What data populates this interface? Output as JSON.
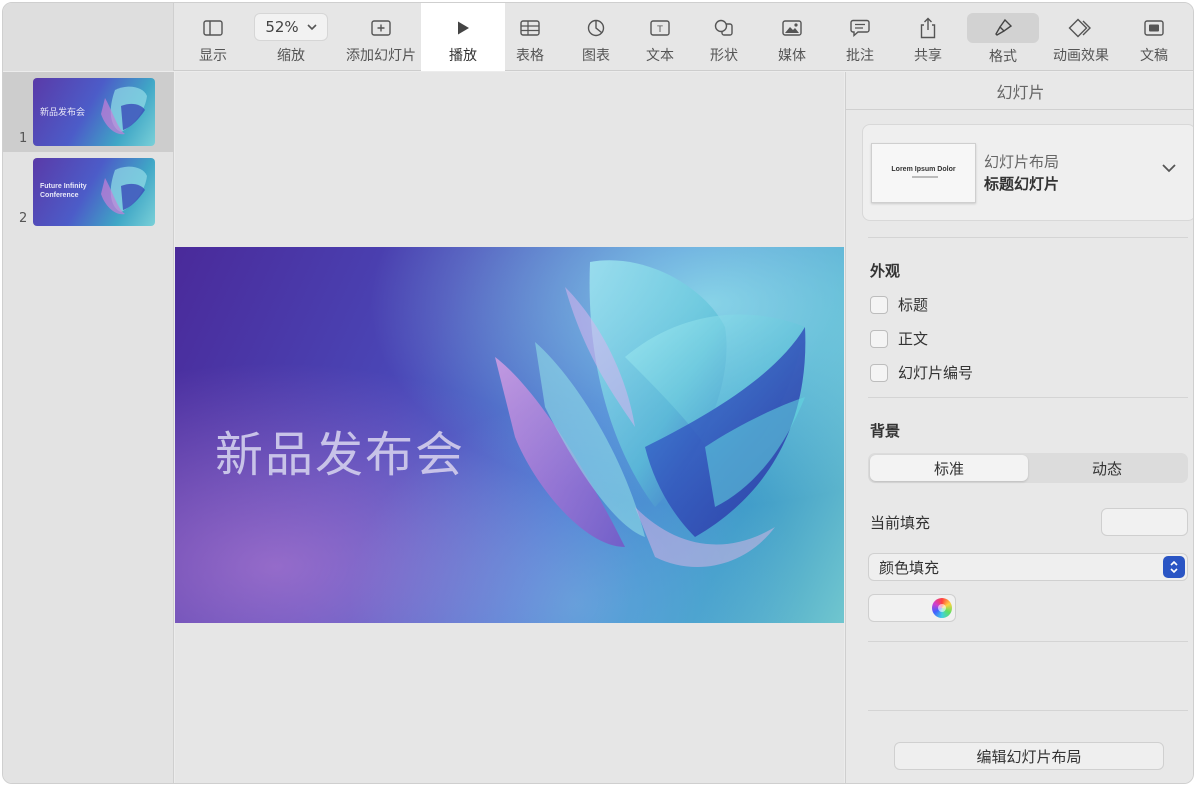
{
  "toolbar": {
    "view_label": "显示",
    "zoom_value": "52%",
    "zoom_label": "缩放",
    "add_slide_label": "添加幻灯片",
    "play_label": "播放",
    "table_label": "表格",
    "chart_label": "图表",
    "text_label": "文本",
    "shape_label": "形状",
    "media_label": "媒体",
    "comment_label": "批注",
    "share_label": "共享",
    "format_label": "格式",
    "animate_label": "动画效果",
    "document_label": "文稿"
  },
  "navigator": {
    "slides": [
      {
        "number": "1",
        "thumb_text": "新品发布会",
        "selected": true
      },
      {
        "number": "2",
        "thumb_text_line1": "Future Infinity",
        "thumb_text_line2": "Conference",
        "selected": false
      }
    ]
  },
  "slide": {
    "title": "新品发布会"
  },
  "inspector": {
    "header": "幻灯片",
    "layout": {
      "thumb_title": "Lorem Ipsum Dolor",
      "label": "幻灯片布局",
      "value": "标题幻灯片"
    },
    "appearance": {
      "title": "外观",
      "options": [
        "标题",
        "正文",
        "幻灯片编号"
      ]
    },
    "background": {
      "title": "背景",
      "segments": [
        "标准",
        "动态"
      ],
      "active_segment": "标准",
      "current_fill_label": "当前填充",
      "fill_type": "颜色填充"
    },
    "edit_layout_button": "编辑幻灯片布局"
  },
  "colors": {
    "select_accent": "#2a55c4",
    "highlight": "#ffffff"
  }
}
